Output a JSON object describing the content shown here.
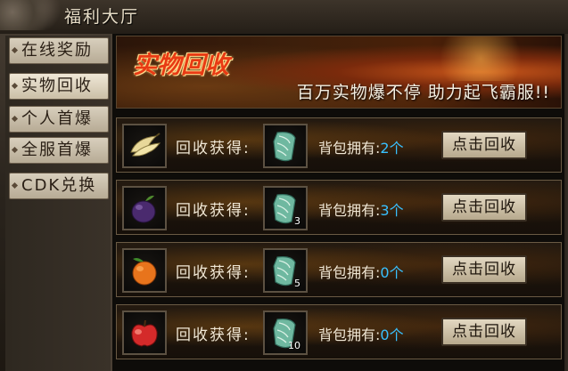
{
  "window": {
    "title": "福利大厅"
  },
  "sidebar": {
    "items": [
      {
        "label": "在线奖励"
      },
      {
        "label": "实物回收"
      },
      {
        "label": "个人首爆"
      },
      {
        "label": "全服首爆"
      },
      {
        "label": "CDK兑换"
      }
    ],
    "active_index": 1
  },
  "banner": {
    "title": "实物回收",
    "slogan": "百万实物爆不停 助力起飞霸服!!"
  },
  "rows": [
    {
      "fruit_icon": "banana-icon",
      "reward_icon": "jade-leaf-icon",
      "reward_count": "",
      "get_label": "回收获得:",
      "own_label": "背包拥有:",
      "own_value": "2个",
      "button_label": "点击回收"
    },
    {
      "fruit_icon": "plum-icon",
      "reward_icon": "jade-leaf-icon",
      "reward_count": "3",
      "get_label": "回收获得:",
      "own_label": "背包拥有:",
      "own_value": "3个",
      "button_label": "点击回收"
    },
    {
      "fruit_icon": "orange-icon",
      "reward_icon": "jade-leaf-icon",
      "reward_count": "5",
      "get_label": "回收获得:",
      "own_label": "背包拥有:",
      "own_value": "0个",
      "button_label": "点击回收"
    },
    {
      "fruit_icon": "apple-icon",
      "reward_icon": "jade-leaf-icon",
      "reward_count": "10",
      "get_label": "回收获得:",
      "own_label": "背包拥有:",
      "own_value": "0个",
      "button_label": "点击回收"
    }
  ],
  "colors": {
    "own_value": "#38c0ff",
    "banner_title": "#e83a14"
  }
}
